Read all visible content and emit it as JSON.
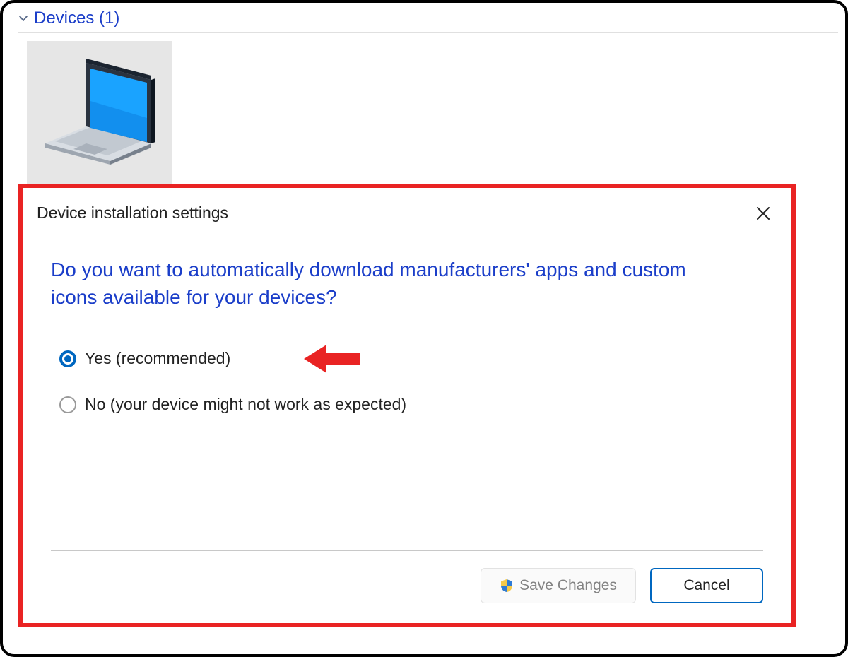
{
  "background": {
    "section_title": "Devices (1)"
  },
  "dialog": {
    "title": "Device installation settings",
    "question": "Do you want to automatically download manufacturers' apps and custom icons available for your devices?",
    "options": {
      "yes": "Yes (recommended)",
      "no": "No (your device might not work as expected)"
    },
    "selected_option": "yes",
    "buttons": {
      "save": "Save Changes",
      "cancel": "Cancel"
    }
  },
  "annotation": {
    "arrow_color": "#e92323",
    "highlight_border_color": "#e92323"
  },
  "icons": {
    "chevron_down": "chevron-down-icon",
    "close": "close-icon",
    "laptop": "laptop-icon",
    "shield": "shield-icon"
  },
  "colors": {
    "link_blue": "#1b3ec9",
    "accent_blue": "#0067c0"
  }
}
